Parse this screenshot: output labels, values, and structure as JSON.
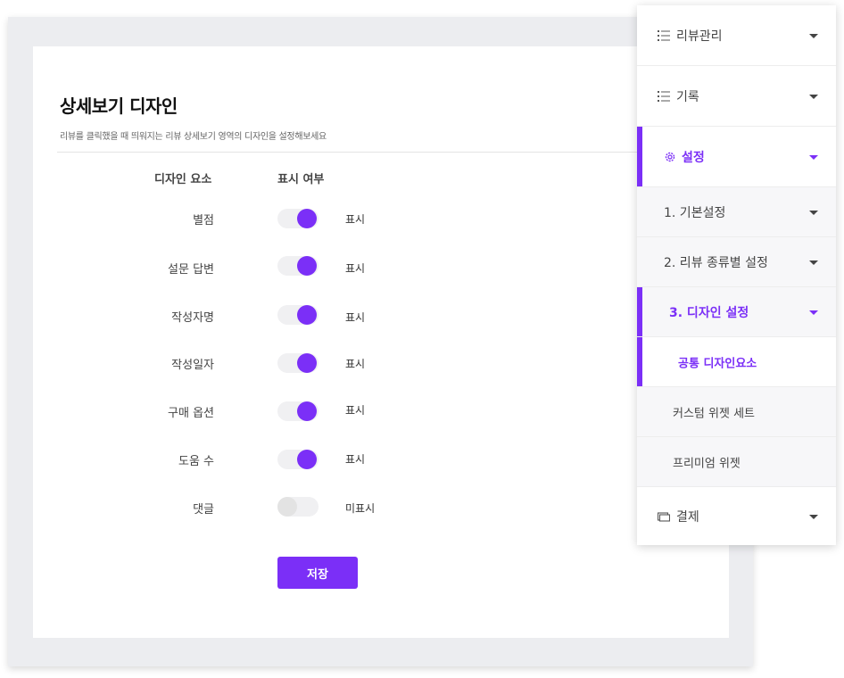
{
  "panel": {
    "title": "상세보기 디자인",
    "subtitle": "리뷰를 클릭했을 때 띄워지는 리뷰 상세보기 영역의 디자인을 설정해보세요",
    "col_element": "디자인 요소",
    "col_display": "표시 여부",
    "rows": [
      {
        "label": "별점",
        "on": true,
        "status": "표시"
      },
      {
        "label": "설문 답변",
        "on": true,
        "status": "표시"
      },
      {
        "label": "작성자명",
        "on": true,
        "status": "표시"
      },
      {
        "label": "작성일자",
        "on": true,
        "status": "표시"
      },
      {
        "label": "구매 옵션",
        "on": true,
        "status": "표시"
      },
      {
        "label": "도움 수",
        "on": true,
        "status": "표시"
      },
      {
        "label": "댓글",
        "on": false,
        "status": "미표시"
      }
    ],
    "save_label": "저장"
  },
  "menu": {
    "items": [
      {
        "label": "리뷰관리",
        "icon": "list-icon"
      },
      {
        "label": "기록",
        "icon": "list-icon"
      },
      {
        "label": "설정",
        "icon": "gear-icon"
      },
      {
        "label": "1. 기본설정"
      },
      {
        "label": "2. 리뷰 종류별 설정"
      },
      {
        "label": "3. 디자인 설정"
      },
      {
        "label": "공통 디자인요소"
      },
      {
        "label": "커스텀 위젯 세트"
      },
      {
        "label": "프리미엄 위젯"
      },
      {
        "label": "결제",
        "icon": "card-icon"
      }
    ]
  },
  "colors": {
    "accent": "#7b2ff7",
    "toggle_off": "#e3e3e3",
    "background": "#ecedf0"
  }
}
